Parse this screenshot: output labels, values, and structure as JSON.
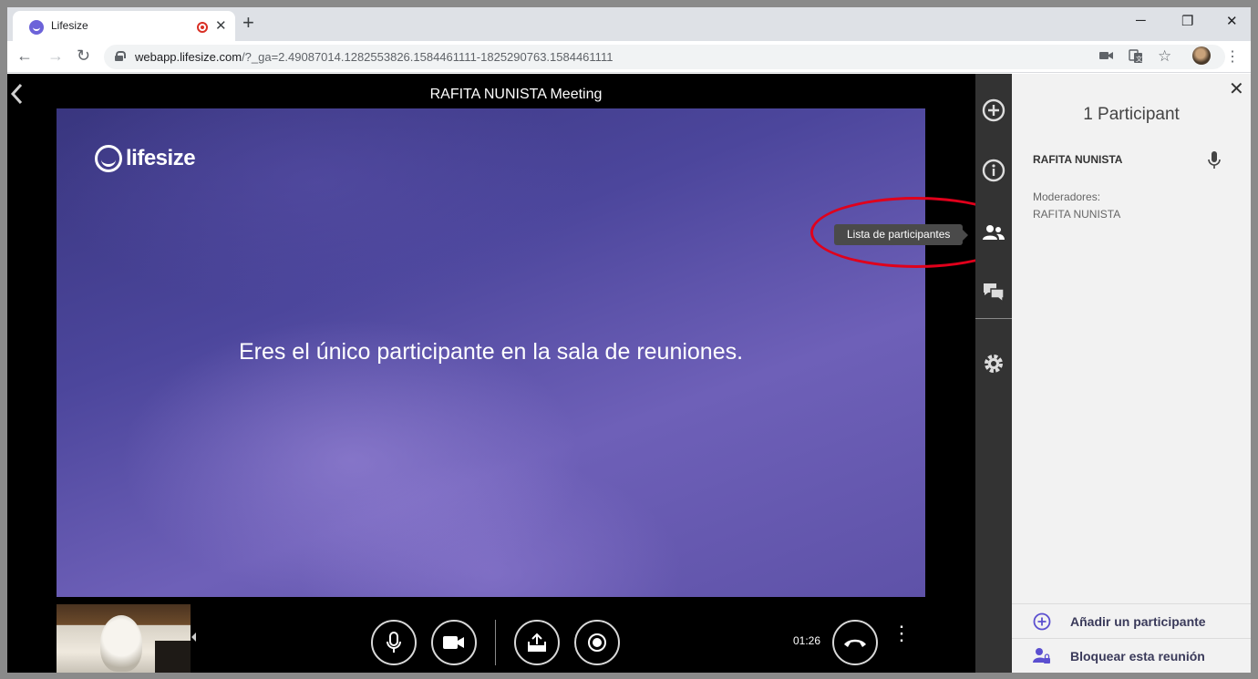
{
  "browser": {
    "tab_title": "Lifesize",
    "new_tab": "+",
    "window_controls": {
      "minimize": "─",
      "maximize": "❐",
      "close": "✕"
    },
    "url_host": "webapp.lifesize.com",
    "url_path": "/?_ga=2.49087014.1282553826.1584461111-1825290763.1584461111"
  },
  "meeting": {
    "title": "RAFITA NUNISTA Meeting",
    "logo_text": "lifesize",
    "alone_message": "Eres el único participante en la sala de reuniones.",
    "timer": "01:26"
  },
  "tooltip": {
    "label": "Lista de participantes"
  },
  "panel": {
    "title": "1 Participant",
    "participants": [
      {
        "name": "RAFITA NUNISTA",
        "mic": "mic-icon"
      }
    ],
    "moderators_label": "Moderadores:",
    "moderator_name": "RAFITA NUNISTA",
    "actions": [
      {
        "label": "Añadir un participante",
        "icon": "add-circle-icon"
      },
      {
        "label": "Bloquear esta reunión",
        "icon": "lock-person-icon"
      }
    ]
  },
  "colors": {
    "accent": "#5b4fd0",
    "annotation": "#e0001b",
    "rail": "#333333",
    "panel_bg": "#f2f2f2"
  }
}
